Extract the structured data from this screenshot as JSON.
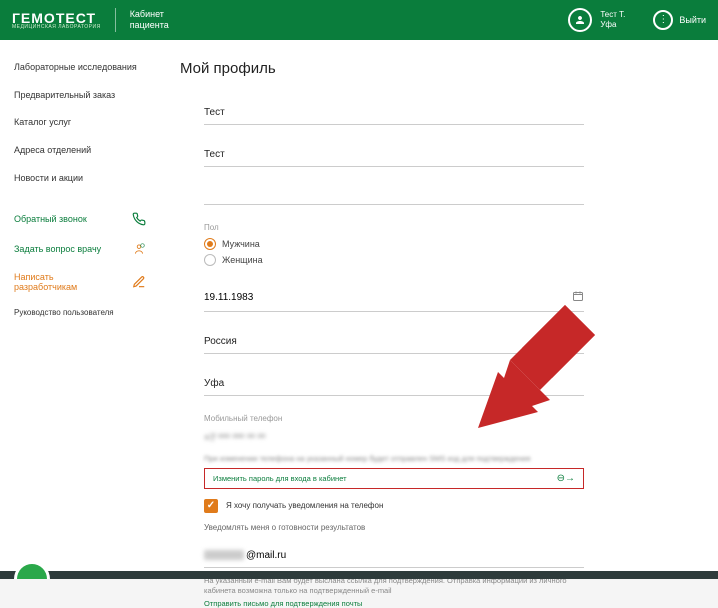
{
  "header": {
    "logo_main": "ГЕМОТЕСТ",
    "logo_sub": "МЕДИЦИНСКАЯ ЛАБОРАТОРИЯ",
    "cab_line1": "Кабинет",
    "cab_line2": "пациента",
    "user_name": "Тест Т.",
    "user_city": "Уфа",
    "logout": "Выйти"
  },
  "sidebar": {
    "items": [
      "Лабораторные исследования",
      "Предварительный заказ",
      "Каталог услуг",
      "Адреса отделений",
      "Новости и акции"
    ],
    "callback": "Обратный звонок",
    "ask_doctor": "Задать вопрос врачу",
    "write_dev_line1": "Написать",
    "write_dev_line2": "разработчикам",
    "manual": "Руководство пользователя"
  },
  "profile": {
    "title": "Мой профиль",
    "first_name": "Тест",
    "last_name": "Тест",
    "sex_label": "Пол",
    "sex_male": "Мужчина",
    "sex_female": "Женщина",
    "birthdate": "19.11.1983",
    "country": "Россия",
    "city": "Уфа",
    "phone_label": "Мобильный телефон",
    "phone_masked": "+7 *** *** ** **",
    "phone_hint": "При изменении телефона на указанный номер будет отправлен SMS код для подтверждения",
    "change_pw": "Изменить пароль для входа в кабинет",
    "phone_notify": "Я хочу получать уведомления на телефон",
    "results_notify": "Уведомлять меня о готовности результатов",
    "email_domain": "@mail.ru",
    "email_hint": "На указанный e-mail Вам будет выслана ссылка для подтверждения. Отправка информации из личного кабинета возможна только на подтвержденный e-mail",
    "resend_link": "Отправить письмо для подтверждения почты"
  }
}
